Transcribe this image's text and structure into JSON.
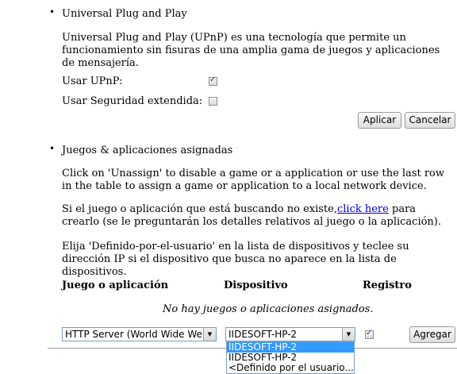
{
  "upnp": {
    "title": "Universal Plug and Play",
    "description": "Universal Plug and Play (UPnP) es una tecnología que permite un funcionamiento sin fisuras de una amplia gama de juegos y aplicaciones de mensajería.",
    "use_upnp_label": "Usar UPnP:",
    "use_upnp_checked": true,
    "extended_security_label": "Usar Seguridad extendida:",
    "extended_security_checked": false,
    "apply_label": "Aplicar",
    "cancel_label": "Cancelar"
  },
  "games": {
    "title": "Juegos & aplicaciones asignadas",
    "para1": "Click on 'Unassign' to disable a game or a application or use the last row in the table to assign a game or application to a local network device.",
    "para2_before": "Si el juego o aplicación que está buscando no existe,",
    "para2_link": "click here",
    "para2_after": " para crearlo (se le preguntarán los detalles relativos al juego o la aplicación).",
    "para3": "Elija 'Definido-por-el-usuario' en la lista de dispositivos y teclee su dirección IP si el dispositivo que busca no aparece en la lista de dispositivos.",
    "table": {
      "headers": [
        "Juego o aplicación",
        "Dispositivo",
        "Registro"
      ],
      "empty_message": "No hay juegos o aplicaciones asignados.",
      "game_select_value": "HTTP Server (World Wide Web)",
      "device_select_value": "IIDESOFT-HP-2",
      "registro_checked": true,
      "add_label": "Agregar"
    },
    "device_options": [
      "IIDESOFT-HP-2",
      "IIDESOFT-HP-2",
      "<Definido por el usuario...>"
    ]
  }
}
